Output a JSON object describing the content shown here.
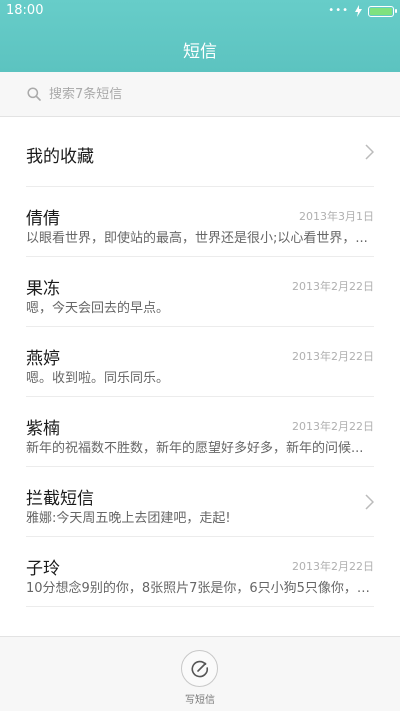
{
  "status_bar": {
    "time": "18:00",
    "signal_dots": "•••",
    "battery_color": "#7fe27f"
  },
  "header": {
    "title": "短信"
  },
  "search": {
    "placeholder": "搜索7条短信"
  },
  "favorites": {
    "label": "我的收藏"
  },
  "threads": [
    {
      "name": "倩倩",
      "date": "2013年3月1日",
      "preview": "以眼看世界，即使站的最高，世界还是很小;以心看世界，..."
    },
    {
      "name": "果冻",
      "date": "2013年2月22日",
      "preview": "嗯，今天会回去的早点。"
    },
    {
      "name": "燕婷",
      "date": "2013年2月22日",
      "preview": "嗯。收到啦。同乐同乐。"
    },
    {
      "name": "紫楠",
      "date": "2013年2月22日",
      "preview": "新年的祝福数不胜数，新年的愿望好多好多，新年的问候..."
    }
  ],
  "blocked": {
    "name": "拦截短信",
    "preview": "雅娜:今天周五晚上去团建吧，走起!"
  },
  "last_thread": {
    "name": "子玲",
    "date": "2013年2月22日",
    "preview": "10分想念9别的你，8张照片7张是你，6只小狗5只像你，4..."
  },
  "compose": {
    "label": "写短信"
  },
  "colors": {
    "header": "#5fc6c3",
    "chevron": "#bbbbbb"
  }
}
